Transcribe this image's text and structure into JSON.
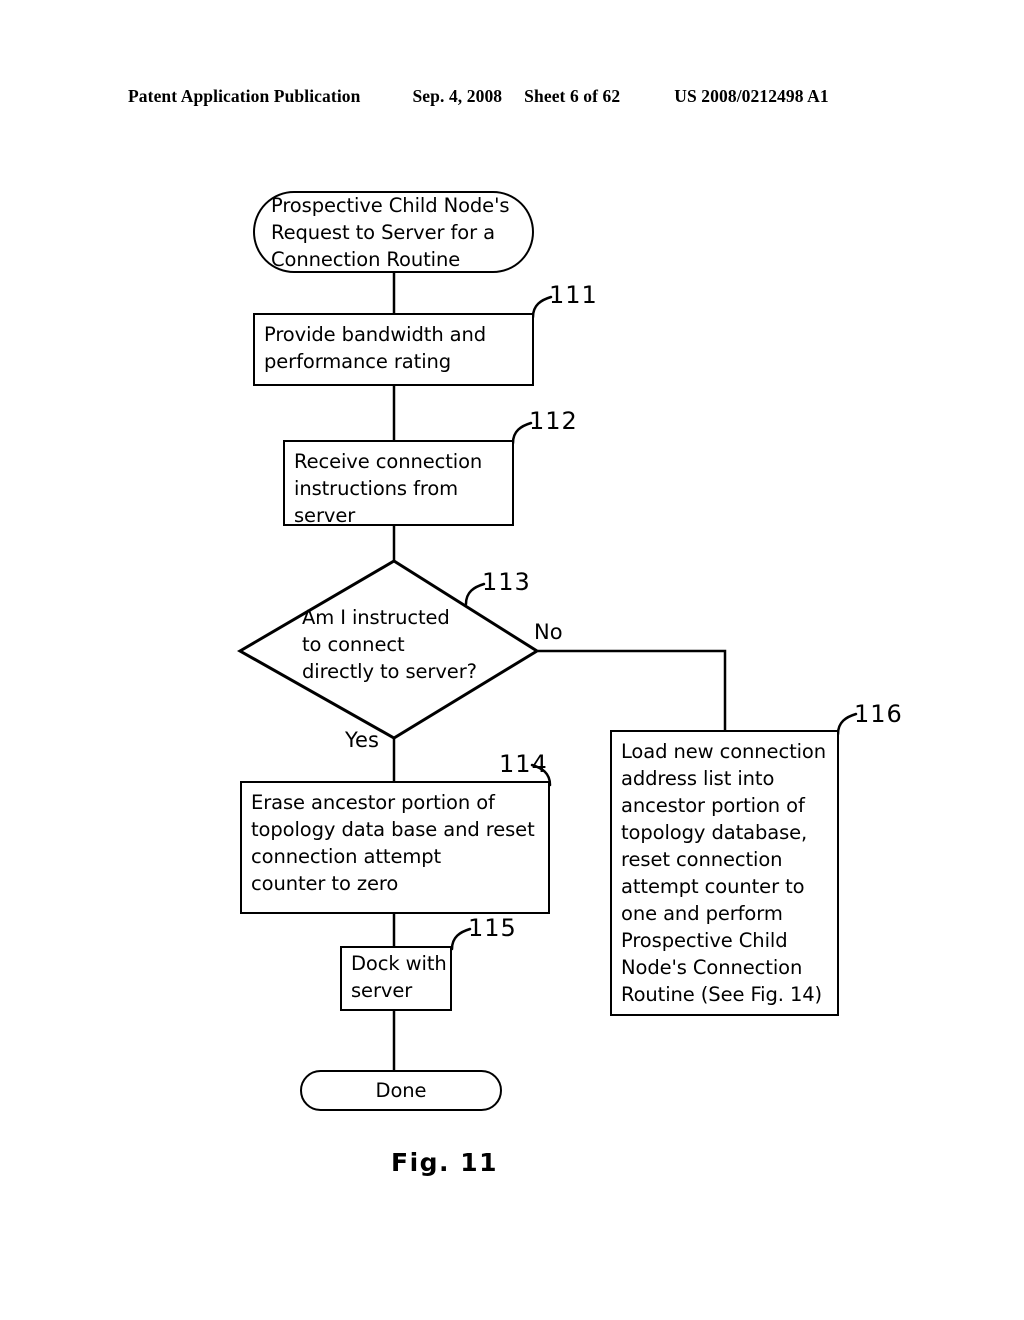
{
  "header": {
    "publication": "Patent Application Publication",
    "date": "Sep. 4, 2008",
    "sheet": "Sheet 6 of 62",
    "patent_number": "US 2008/0212498 A1"
  },
  "figure": {
    "caption": "Fig. 11",
    "title": "Prospective Child Node's Request to Server for a Connection Routine"
  },
  "nodes": {
    "start": {
      "shape": "terminator",
      "text": "Prospective Child Node's\nRequest to Server for a\nConnection Routine"
    },
    "n111": {
      "shape": "process",
      "ref": "111",
      "text": "Provide bandwidth and\nperformance rating"
    },
    "n112": {
      "shape": "process",
      "ref": "112",
      "text": "Receive connection\ninstructions from\nserver"
    },
    "n113": {
      "shape": "decision",
      "ref": "113",
      "text": "Am I instructed\nto connect\ndirectly to server?"
    },
    "n114": {
      "shape": "process",
      "ref": "114",
      "text": "Erase ancestor portion of\ntopology data base and reset\nconnection attempt\ncounter to zero"
    },
    "n115": {
      "shape": "process",
      "ref": "115",
      "text": "Dock with\nserver"
    },
    "n116": {
      "shape": "process",
      "ref": "116",
      "text": "Load new connection\naddress list into\nancestor portion of\ntopology database,\nreset connection\nattempt counter to\none and perform\nProspective Child\nNode's Connection\nRoutine (See Fig. 14)"
    },
    "done": {
      "shape": "terminator",
      "text": "Done"
    }
  },
  "branches": {
    "yes_label": "Yes",
    "no_label": "No"
  },
  "colors": {
    "ink": "#000000",
    "page": "#ffffff"
  }
}
